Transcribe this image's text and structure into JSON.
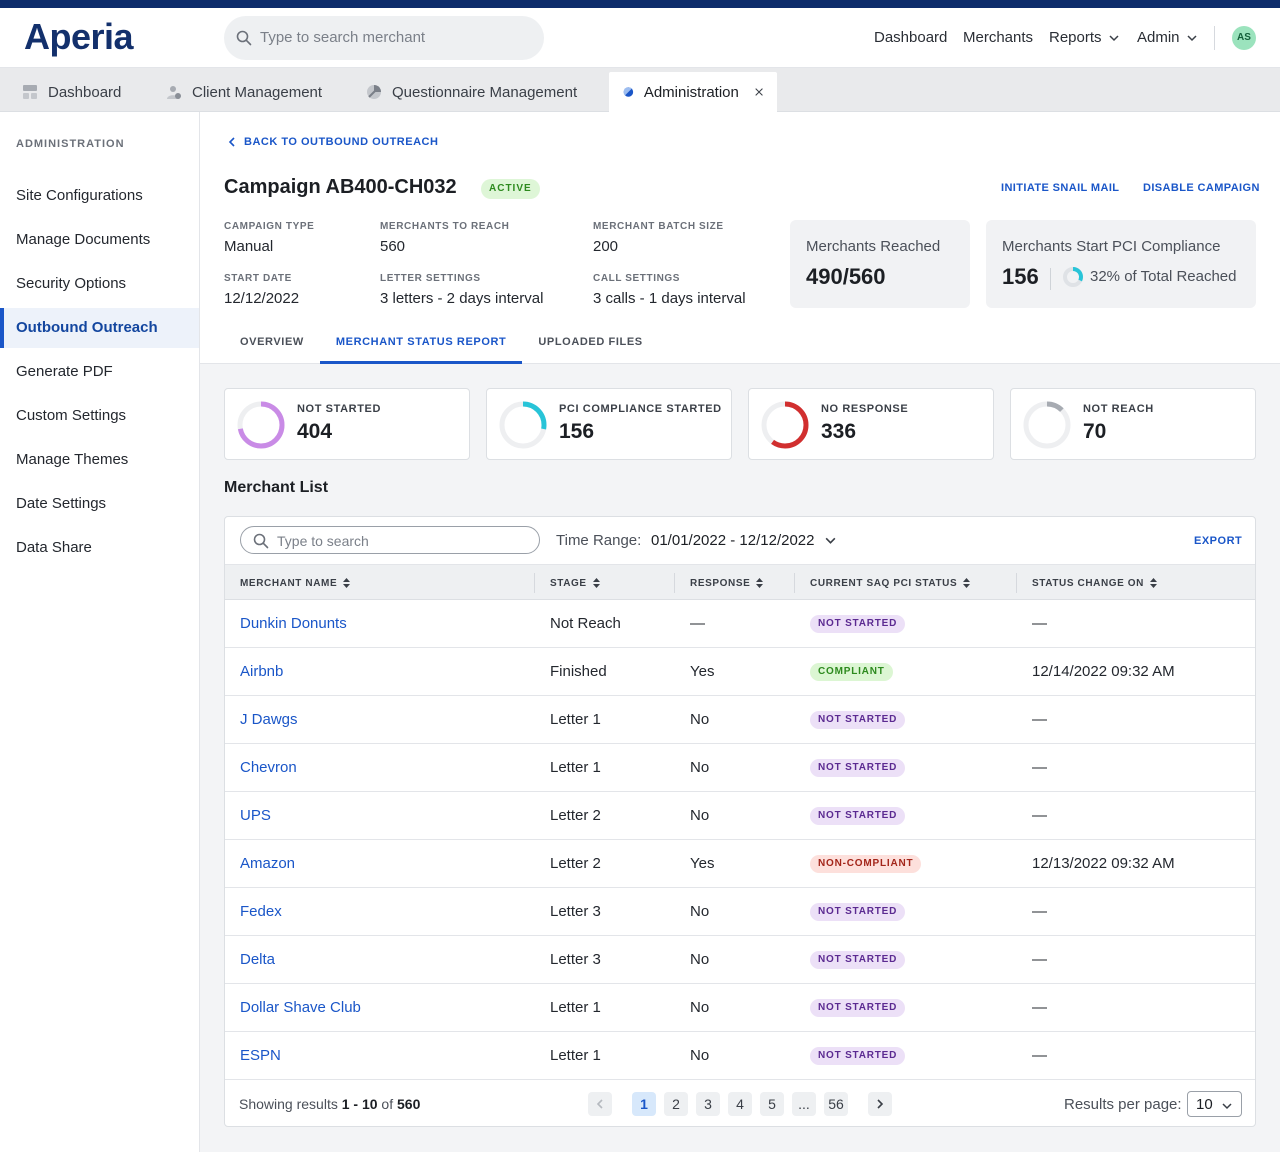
{
  "app": {
    "logo": "Aperia",
    "search_placeholder": "Type to search merchant",
    "user_initials": "AS"
  },
  "topnav": {
    "dashboard": "Dashboard",
    "merchants": "Merchants",
    "reports": "Reports",
    "admin": "Admin"
  },
  "tabs": {
    "dashboard": "Dashboard",
    "client_management": "Client Management",
    "questionnaire_management": "Questionnaire Management",
    "administration": "Administration"
  },
  "sidebar": {
    "heading": "ADMINISTRATION",
    "items": [
      "Site Configurations",
      "Manage Documents",
      "Security Options",
      "Outbound Outreach",
      "Generate PDF",
      "Custom Settings",
      "Manage Themes",
      "Date Settings",
      "Data Share"
    ],
    "active": "Outbound Outreach"
  },
  "campaign": {
    "back_label": "BACK TO OUTBOUND OUTREACH",
    "title": "Campaign AB400-CH032",
    "status": "ACTIVE",
    "action_snail_mail": "INITIATE SNAIL MAIL",
    "action_disable": "DISABLE CAMPAIGN",
    "fields": {
      "campaign_type_label": "CAMPAIGN TYPE",
      "campaign_type": "Manual",
      "merchants_to_reach_label": "MERCHANTS TO REACH",
      "merchants_to_reach": "560",
      "batch_size_label": "MERCHANT BATCH SIZE",
      "batch_size": "200",
      "start_date_label": "START DATE",
      "start_date": "12/12/2022",
      "letter_settings_label": "LETTER SETTINGS",
      "letter_settings": "3 letters - 2 days interval",
      "call_settings_label": "CALL SETTINGS",
      "call_settings": "3 calls - 1 days interval"
    },
    "kpi_reached": {
      "label": "Merchants Reached",
      "value": "490/560"
    },
    "kpi_pci": {
      "label": "Merchants Start PCI Compliance",
      "value": "156",
      "percent_text": "32% of Total Reached",
      "percent": 0.32,
      "color": "#28c4d8"
    }
  },
  "subtabs": {
    "overview": "OVERVIEW",
    "status_report": "MERCHANT STATUS REPORT",
    "uploaded": "UPLOADED FILES"
  },
  "status_cards": [
    {
      "label": "NOT STARTED",
      "value": "404",
      "fraction": 0.72,
      "color": "#c98be6"
    },
    {
      "label": "PCI COMPLIANCE STARTED",
      "value": "156",
      "fraction": 0.28,
      "color": "#28c4d8"
    },
    {
      "label": "NO RESPONSE",
      "value": "336",
      "fraction": 0.6,
      "color": "#d12f2f"
    },
    {
      "label": "NOT REACH",
      "value": "70",
      "fraction": 0.125,
      "color": "#a7abb2"
    }
  ],
  "merchant_list": {
    "title": "Merchant List",
    "search_placeholder": "Type to search",
    "time_range_label": "Time Range:",
    "time_range_value": "01/01/2022 - 12/12/2022",
    "export_label": "EXPORT",
    "columns": [
      "MERCHANT NAME",
      "STAGE",
      "RESPONSE",
      "CURRENT SAQ PCI STATUS",
      "STATUS CHANGE ON"
    ],
    "rows": [
      {
        "name": "Dunkin Donunts",
        "stage": "Not Reach",
        "response": "—",
        "status": "NOT STARTED",
        "status_kind": "ns",
        "changed": "—"
      },
      {
        "name": "Airbnb",
        "stage": "Finished",
        "response": "Yes",
        "status": "COMPLIANT",
        "status_kind": "cp",
        "changed": "12/14/2022 09:32 AM"
      },
      {
        "name": "J Dawgs",
        "stage": "Letter 1",
        "response": "No",
        "status": "NOT STARTED",
        "status_kind": "ns",
        "changed": "—"
      },
      {
        "name": "Chevron",
        "stage": "Letter 1",
        "response": "No",
        "status": "NOT STARTED",
        "status_kind": "ns",
        "changed": "—"
      },
      {
        "name": "UPS",
        "stage": "Letter 2",
        "response": "No",
        "status": "NOT STARTED",
        "status_kind": "ns",
        "changed": "—"
      },
      {
        "name": "Amazon",
        "stage": "Letter 2",
        "response": "Yes",
        "status": "NON-COMPLIANT",
        "status_kind": "nc",
        "changed": "12/13/2022 09:32 AM"
      },
      {
        "name": "Fedex",
        "stage": "Letter 3",
        "response": "No",
        "status": "NOT STARTED",
        "status_kind": "ns",
        "changed": "—"
      },
      {
        "name": "Delta",
        "stage": "Letter 3",
        "response": "No",
        "status": "NOT STARTED",
        "status_kind": "ns",
        "changed": "—"
      },
      {
        "name": "Dollar Shave Club",
        "stage": "Letter 1",
        "response": "No",
        "status": "NOT STARTED",
        "status_kind": "ns",
        "changed": "—"
      },
      {
        "name": "ESPN",
        "stage": "Letter 1",
        "response": "No",
        "status": "NOT STARTED",
        "status_kind": "ns",
        "changed": "—"
      }
    ],
    "footer": {
      "showing_prefix": "Showing results",
      "range": "1 - 10",
      "of": "of",
      "total": "560",
      "pages": [
        "1",
        "2",
        "3",
        "4",
        "5",
        "...",
        "56"
      ],
      "current_page": "1",
      "per_page_label": "Results per page:",
      "per_page": "10"
    }
  }
}
